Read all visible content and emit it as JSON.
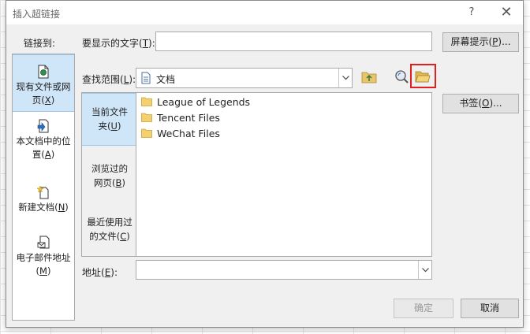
{
  "dialog": {
    "title": "插入超链接",
    "help_glyph": "?",
    "close_glyph": "✕"
  },
  "sidebar": {
    "heading": "链接到:",
    "items": [
      {
        "label_a": "现有文件或网",
        "label_b": "页(",
        "key": "X",
        "label_c": ")",
        "icon": "file-web-icon",
        "selected": true
      },
      {
        "label_a": "本文档中的位",
        "label_b": "置(",
        "key": "A",
        "label_c": ")",
        "icon": "doc-location-icon",
        "selected": false
      },
      {
        "label_a": "新建文档(",
        "label_b": "",
        "key": "N",
        "label_c": ")",
        "icon": "new-doc-icon",
        "selected": false
      },
      {
        "label_a": "电子邮件地址",
        "label_b": "(",
        "key": "M",
        "label_c": ")",
        "icon": "email-icon",
        "selected": false
      }
    ]
  },
  "display_text": {
    "label_a": "要显示的文字(",
    "key": "T",
    "label_b": "):",
    "value": ""
  },
  "screentip_button": {
    "label_a": "屏幕提示(",
    "key": "P",
    "label_b": ")..."
  },
  "look_in": {
    "label_a": "查找范围(",
    "key": "L",
    "label_b": "):",
    "value": "文档",
    "icon": "documents-folder-icon"
  },
  "toolbar": {
    "up_folder_icon": "up-folder-icon",
    "browse_web_icon": "browse-web-icon",
    "browse_file_icon": "browse-file-icon"
  },
  "bookmark_button": {
    "label_a": "书签(",
    "key": "O",
    "label_b": ")..."
  },
  "scope": {
    "items": [
      {
        "line1": "当前文件",
        "line2a": "夹(",
        "key": "U",
        "line2b": ")",
        "selected": true
      },
      {
        "line1": "浏览过的",
        "line2a": "网页(",
        "key": "B",
        "line2b": ")",
        "selected": false
      },
      {
        "line1": "最近使用过",
        "line2a": "的文件(",
        "key": "C",
        "line2b": ")",
        "selected": false
      }
    ]
  },
  "files": [
    {
      "name": "League of Legends",
      "icon": "folder-icon"
    },
    {
      "name": "Tencent Files",
      "icon": "folder-icon"
    },
    {
      "name": "WeChat Files",
      "icon": "folder-icon"
    }
  ],
  "address": {
    "label_a": "地址(",
    "key": "E",
    "label_b": "):",
    "value": ""
  },
  "ok_button": {
    "label": "确定",
    "enabled": false
  },
  "cancel_button": {
    "label": "取消"
  }
}
